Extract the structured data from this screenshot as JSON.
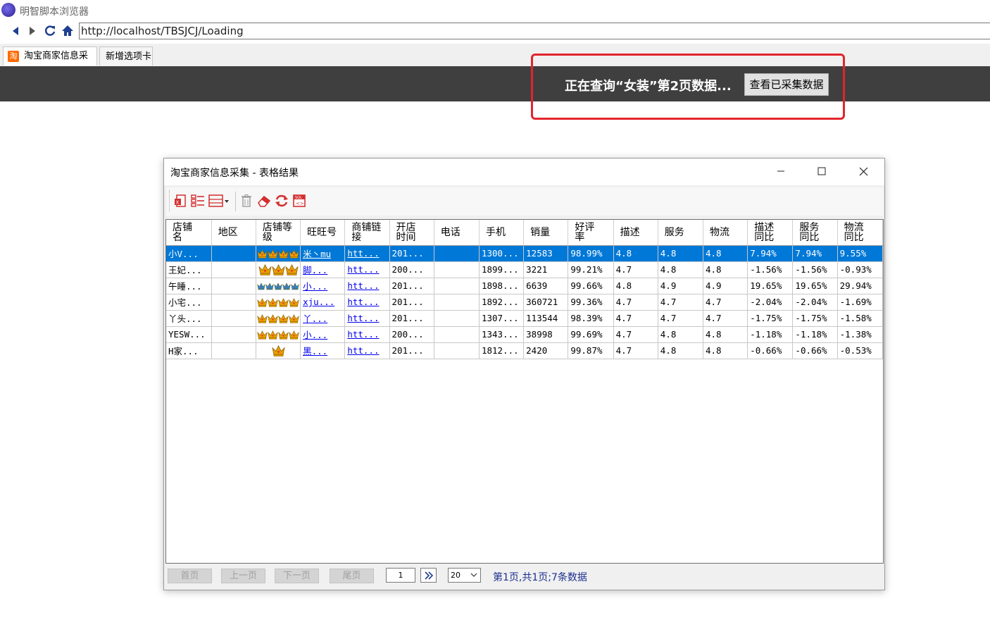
{
  "app": {
    "title": "明智脚本浏览器"
  },
  "navigation": {
    "url": "http://localhost/TBSJCJ/Loading"
  },
  "tabs": [
    {
      "label": "淘宝商家信息采集",
      "icon_text": "淘"
    },
    {
      "label": "新增选项卡"
    }
  ],
  "banner": {
    "status": "正在查询“女装”第2页数据...",
    "view_button": "查看已采集数据"
  },
  "dialog": {
    "title": "淘宝商家信息采集 - 表格结果",
    "toolbar_icons": [
      "export-excel-icon",
      "column-select-icon",
      "layout-icon",
      "delete-icon",
      "eraser-icon",
      "refresh-icon",
      "sql-export-icon"
    ],
    "columns": [
      "店铺名",
      "地区",
      "店铺等级",
      "旺旺号",
      "商铺链接",
      "开店时间",
      "电话",
      "手机",
      "销量",
      "好评率",
      "描述",
      "服务",
      "物流",
      "描述同比",
      "服务同比",
      "物流同比"
    ],
    "column_headers": [
      [
        "店铺",
        "名"
      ],
      [
        "地区"
      ],
      [
        "店铺等",
        "级"
      ],
      [
        "旺旺号"
      ],
      [
        "商铺链",
        "接"
      ],
      [
        "开店",
        "时间"
      ],
      [
        "电话"
      ],
      [
        "手机"
      ],
      [
        "销量"
      ],
      [
        "好评",
        "率"
      ],
      [
        "描述"
      ],
      [
        "服务"
      ],
      [
        "物流"
      ],
      [
        "描述",
        "同比"
      ],
      [
        "服务",
        "同比"
      ],
      [
        "物流",
        "同比"
      ]
    ],
    "rows": [
      {
        "shop": "小V...",
        "region": "",
        "level": "crown4",
        "wangwang": "米丶mu",
        "link": "htt...",
        "opened": "201...",
        "phone": "",
        "mobile": "1300...",
        "sales": "12583",
        "rating": "98.99%",
        "desc": "4.8",
        "service": "4.8",
        "logistics": "4.8",
        "desc_cmp": "7.94%",
        "service_cmp": "7.94%",
        "logistics_cmp": "9.55%",
        "selected": true
      },
      {
        "shop": "王妃...",
        "region": "",
        "level": "crown3",
        "wangwang": "脚...",
        "link": "htt...",
        "opened": "200...",
        "phone": "",
        "mobile": "1899...",
        "sales": "3221",
        "rating": "99.21%",
        "desc": "4.7",
        "service": "4.8",
        "logistics": "4.8",
        "desc_cmp": "-1.56%",
        "service_cmp": "-1.56%",
        "logistics_cmp": "-0.93%"
      },
      {
        "shop": "午睡...",
        "region": "",
        "level": "bluecrown5",
        "wangwang": "小...",
        "link": "htt...",
        "opened": "201...",
        "phone": "",
        "mobile": "1898...",
        "sales": "6639",
        "rating": "99.66%",
        "desc": "4.8",
        "service": "4.9",
        "logistics": "4.9",
        "desc_cmp": "19.65%",
        "service_cmp": "19.65%",
        "logistics_cmp": "29.94%"
      },
      {
        "shop": "小宅...",
        "region": "",
        "level": "crown4",
        "wangwang": "xju...",
        "link": "htt...",
        "opened": "201...",
        "phone": "",
        "mobile": "1892...",
        "sales": "360721",
        "rating": "99.36%",
        "desc": "4.7",
        "service": "4.7",
        "logistics": "4.7",
        "desc_cmp": "-2.04%",
        "service_cmp": "-2.04%",
        "logistics_cmp": "-1.69%"
      },
      {
        "shop": "丫头...",
        "region": "",
        "level": "crown4",
        "wangwang": "丫...",
        "link": "htt...",
        "opened": "201...",
        "phone": "",
        "mobile": "1307...",
        "sales": "113544",
        "rating": "98.39%",
        "desc": "4.7",
        "service": "4.7",
        "logistics": "4.7",
        "desc_cmp": "-1.75%",
        "service_cmp": "-1.75%",
        "logistics_cmp": "-1.58%"
      },
      {
        "shop": "YESW...",
        "region": "",
        "level": "crown4",
        "wangwang": "小...",
        "link": "htt...",
        "opened": "200...",
        "phone": "",
        "mobile": "1343...",
        "sales": "38998",
        "rating": "99.69%",
        "desc": "4.7",
        "service": "4.8",
        "logistics": "4.8",
        "desc_cmp": "-1.18%",
        "service_cmp": "-1.18%",
        "logistics_cmp": "-1.38%"
      },
      {
        "shop": "H家...",
        "region": "",
        "level": "crown1",
        "wangwang": "黑...",
        "link": "htt...",
        "opened": "201...",
        "phone": "",
        "mobile": "1812...",
        "sales": "2420",
        "rating": "99.87%",
        "desc": "4.7",
        "service": "4.8",
        "logistics": "4.8",
        "desc_cmp": "-0.66%",
        "service_cmp": "-0.66%",
        "logistics_cmp": "-0.53%"
      }
    ]
  },
  "pager": {
    "first": "首页",
    "prev": "上一页",
    "next": "下一页",
    "last": "尾页",
    "current_page": "1",
    "page_size": "20",
    "info": "第1页,共1页;7条数据"
  },
  "colors": {
    "banner_bg": "#3f3f3f",
    "highlight": "#e2252b",
    "selection": "#0078d7",
    "crown_gold": "#e8a000",
    "crown_blue": "#1e8bd6"
  }
}
